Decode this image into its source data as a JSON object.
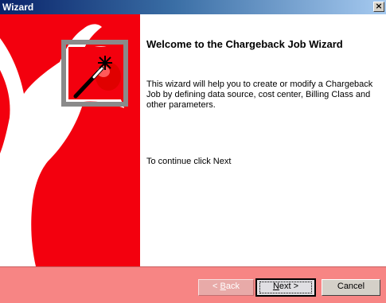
{
  "window": {
    "title": "Wizard",
    "close_glyph": "×"
  },
  "page": {
    "heading": "Welcome to the Chargeback Job Wizard",
    "description": "This wizard will help you to create or modify a Chargeback Job by defining data source, cost center, Billing Class and other parameters.",
    "continue_text": "To continue click Next"
  },
  "buttons": {
    "back_mnemonic": "B",
    "back_prefix": "< ",
    "back_rest": "ack",
    "back_enabled": false,
    "next_mnemonic": "N",
    "next_rest": "ext >",
    "next_default": true,
    "cancel_label": "Cancel"
  },
  "side_panel": {
    "art": "deer-antler-silhouette",
    "icon": "magic-wand-icon"
  },
  "colors": {
    "side_panel_red": "#f3000e",
    "footer_pink": "#f78584",
    "title_blue": "#0a246a"
  }
}
